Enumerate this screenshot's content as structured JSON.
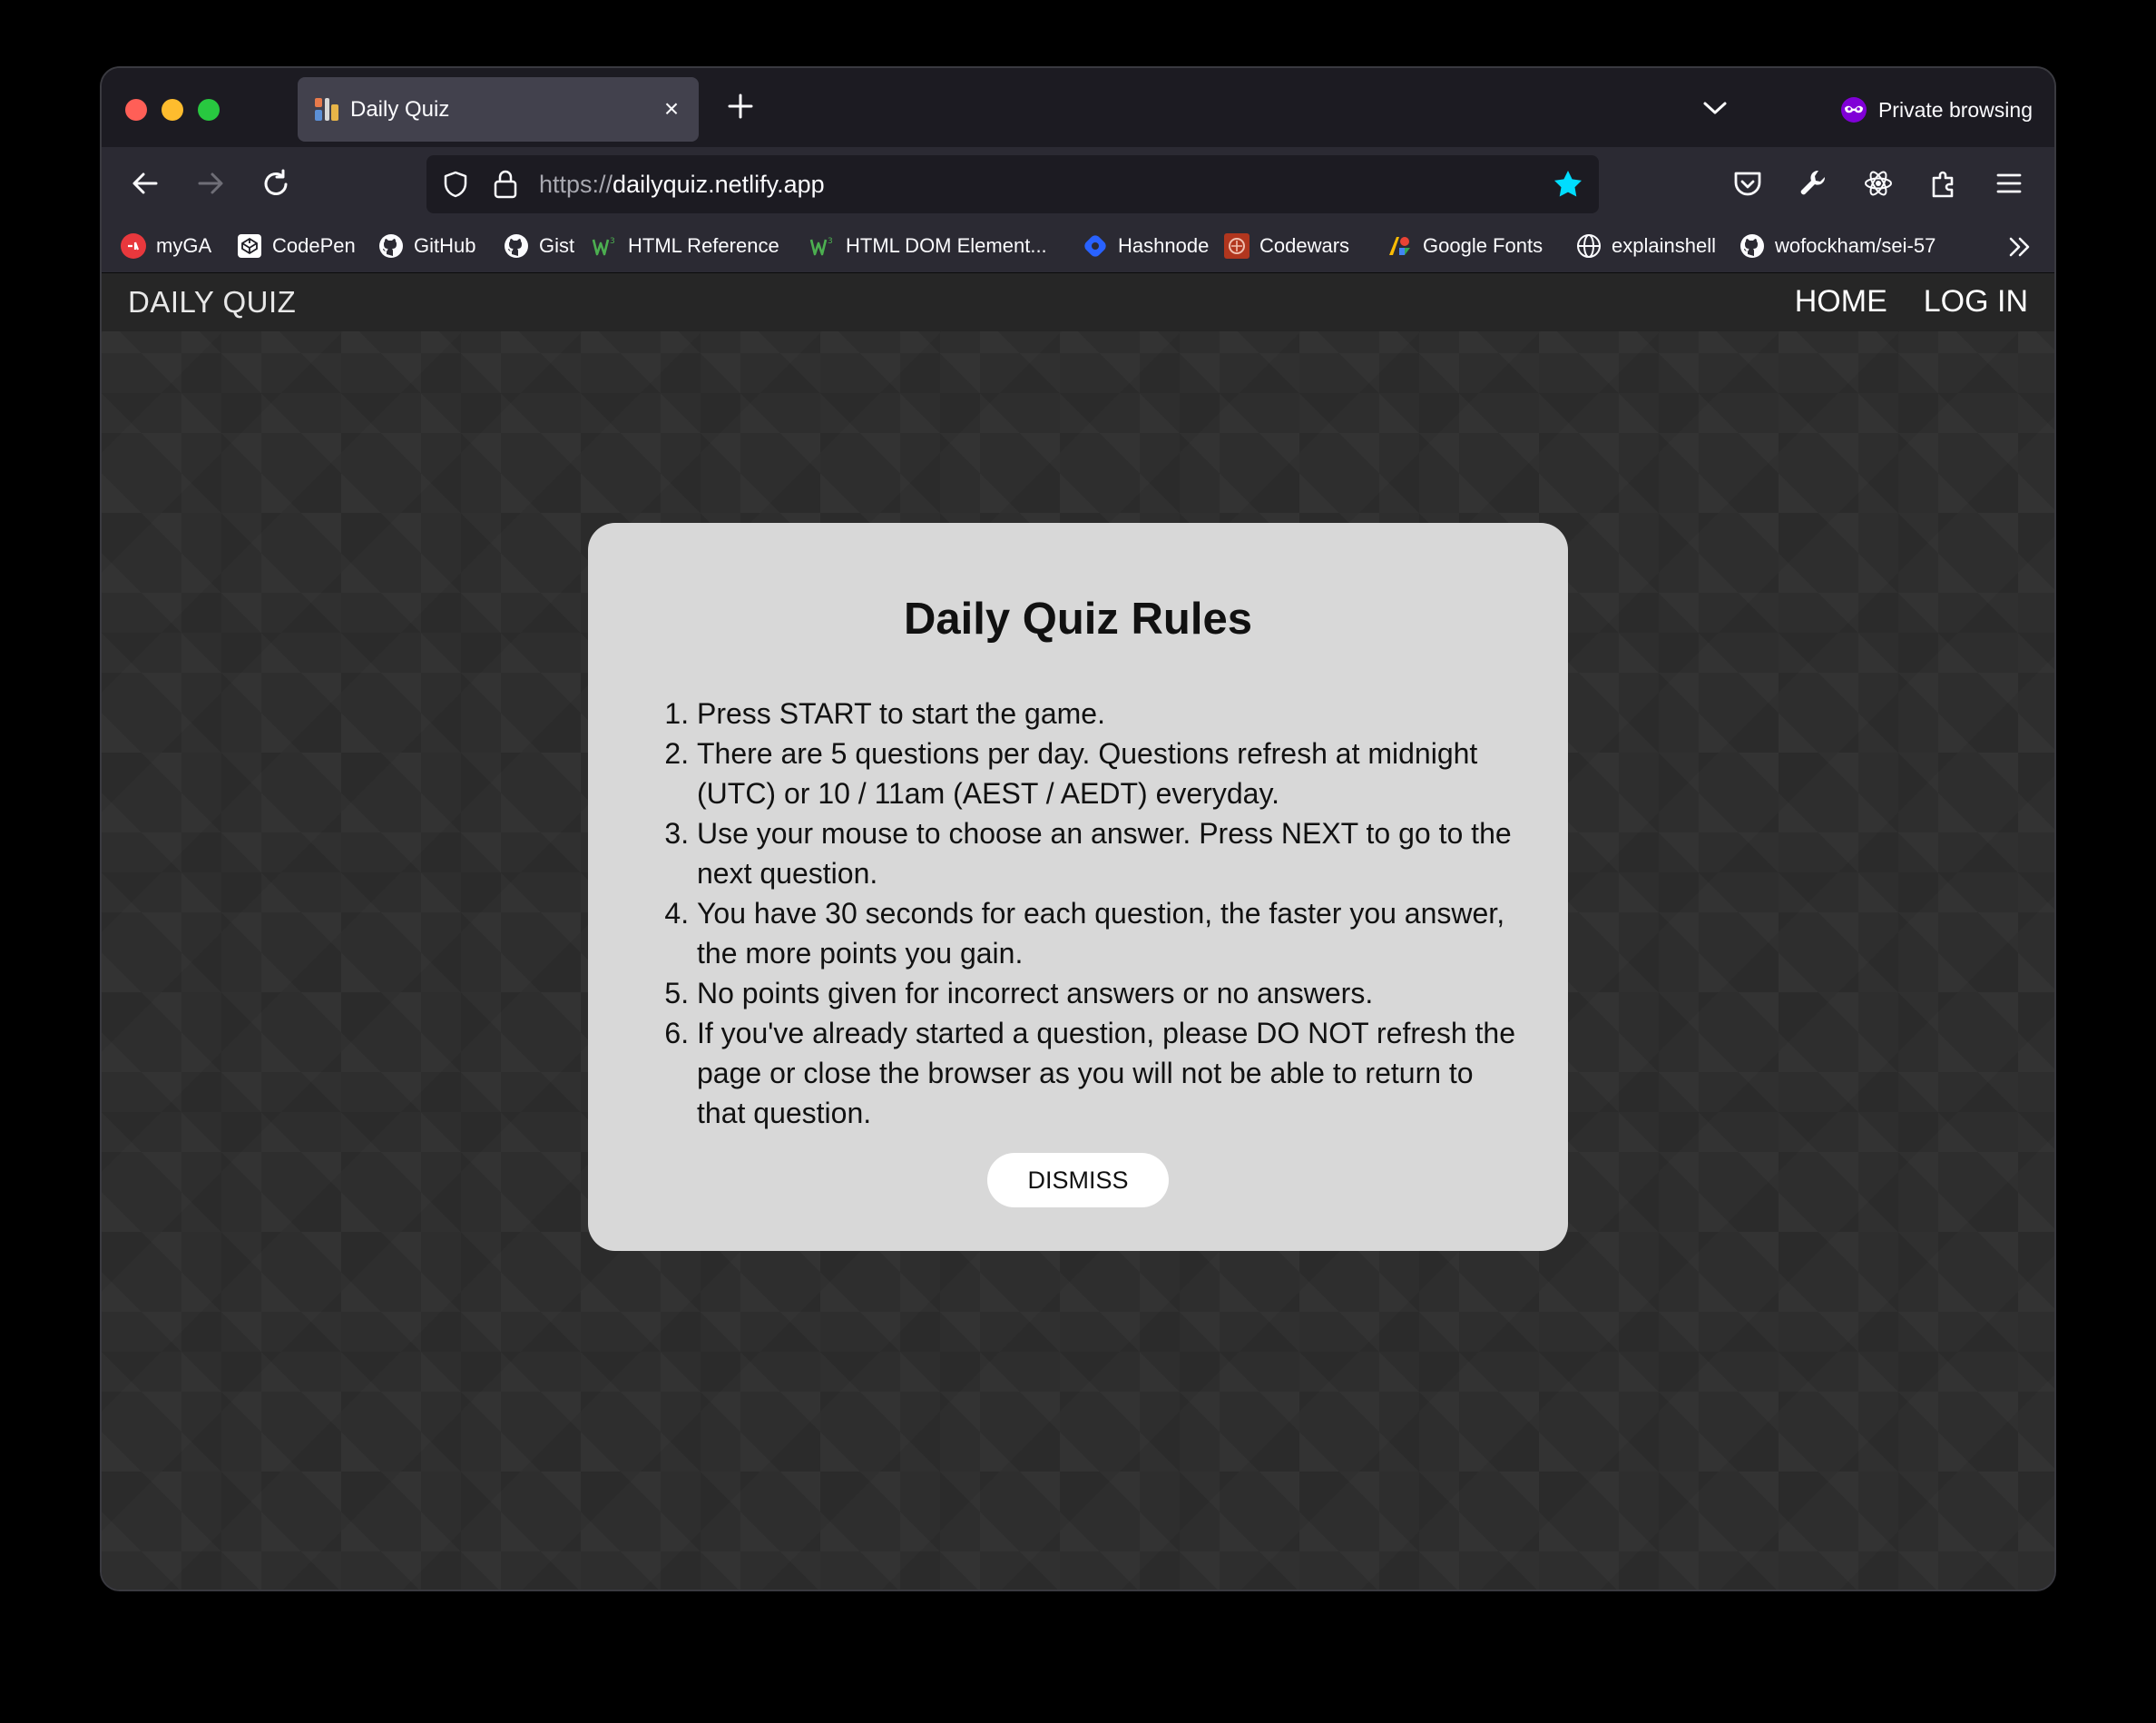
{
  "browser": {
    "tab_title": "Daily Quiz",
    "tab_close": "×",
    "private_label": "Private browsing",
    "url_scheme": "https://",
    "url_host": "dailyquiz.netlify.app",
    "accent_color": "#00ddff",
    "private_color": "#8000d7"
  },
  "bookmarks": [
    {
      "label": "myGA",
      "icon": "myga-icon"
    },
    {
      "label": "CodePen",
      "icon": "codepen-icon"
    },
    {
      "label": "GitHub",
      "icon": "github-icon"
    },
    {
      "label": "Gist",
      "icon": "github-icon"
    },
    {
      "label": "HTML Reference",
      "icon": "w3-icon"
    },
    {
      "label": "HTML DOM Element...",
      "icon": "w3-icon"
    },
    {
      "label": "Hashnode",
      "icon": "hashnode-icon"
    },
    {
      "label": "Codewars",
      "icon": "codewars-icon"
    },
    {
      "label": "Google Fonts",
      "icon": "google-fonts-icon"
    },
    {
      "label": "explainshell",
      "icon": "globe-icon"
    },
    {
      "label": "wofockham/sei-57",
      "icon": "github-icon"
    }
  ],
  "site": {
    "brand": "DAILY QUIZ",
    "nav": {
      "home": "HOME",
      "login": "LOG IN"
    }
  },
  "modal": {
    "title": "Daily Quiz Rules",
    "rules": [
      "Press START to start the game.",
      "There are 5 questions per day. Questions refresh at midnight (UTC) or 10 / 11am (AEST / AEDT) everyday.",
      "Use your mouse to choose an answer. Press NEXT to go to the next question.",
      "You have 30 seconds for each question, the faster you answer, the more points you gain.",
      "No points given for incorrect answers or no answers.",
      "If you've already started a question, please DO NOT refresh the page or close the browser as you will not be able to return to that question."
    ],
    "dismiss_label": "DISMISS"
  }
}
